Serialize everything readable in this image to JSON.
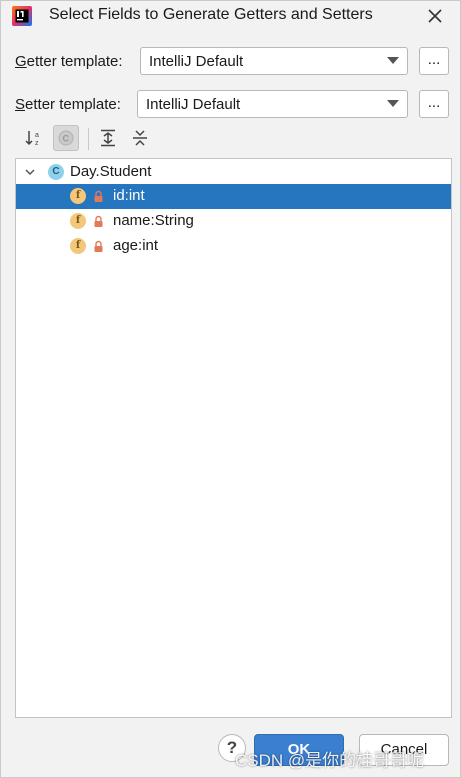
{
  "window": {
    "title": "Select Fields to Generate Getters and Setters",
    "close_icon": "close-icon"
  },
  "getter": {
    "label_mnemonic": "G",
    "label_rest": "etter template:",
    "value": "IntelliJ Default",
    "more_label": "..."
  },
  "setter": {
    "label_mnemonic": "S",
    "label_rest": "etter template:",
    "value": "IntelliJ Default",
    "more_label": "..."
  },
  "toolbar": {
    "items": [
      {
        "icon": "sort-alphabetically-icon",
        "active": false
      },
      {
        "icon": "show-classes-icon",
        "active": true
      },
      {
        "icon": "expand-all-icon",
        "active": false
      },
      {
        "icon": "collapse-all-icon",
        "active": false
      }
    ]
  },
  "tree": {
    "root": {
      "icon": "class-icon",
      "icon_letter": "C",
      "label": "Day.Student",
      "expanded": true
    },
    "fields": [
      {
        "icon_letter": "f",
        "label": "id:int",
        "selected": true
      },
      {
        "icon_letter": "f",
        "label": "name:String",
        "selected": false
      },
      {
        "icon_letter": "f",
        "label": "age:int",
        "selected": false
      }
    ]
  },
  "footer": {
    "help_label": "?",
    "ok_label": "OK",
    "cancel_label": "Cancel"
  },
  "watermark": "CSDN @是你的桂哥哥呢",
  "colors": {
    "selection": "#2675bf",
    "primary_button": "#3a7fd0",
    "class_icon": "#8fd0ea",
    "field_icon": "#f4c87a",
    "lock_icon": "#e07a5a"
  }
}
